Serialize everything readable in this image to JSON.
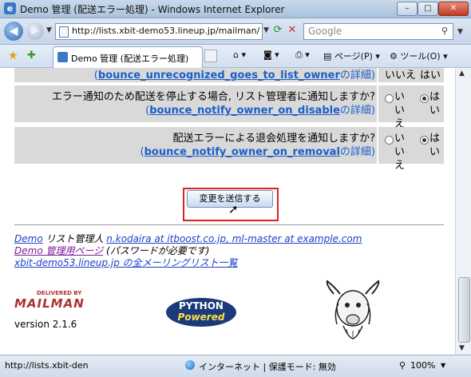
{
  "window": {
    "title": "Demo 管理 (配送エラー処理) - Windows Internet Explorer",
    "minimize_glyph": "–",
    "maximize_glyph": "□",
    "close_glyph": "✕"
  },
  "nav": {
    "address": "http://lists.xbit-demo53.lineup.jp/mailman/",
    "search_placeholder": "Google"
  },
  "toolbar": {
    "tab_label": "Demo 管理 (配送エラー処理)",
    "page_menu": "ページ(P)",
    "tools_menu": "ツール(O)"
  },
  "settings": [
    {
      "question": "",
      "link": "bounce_unrecognized_goes_to_list_owner",
      "link_suffix": "の詳細",
      "options": [
        "いいえ",
        "はい"
      ],
      "selected": 1
    },
    {
      "question": "エラー通知のため配送を停止する場合, リスト管理者に通知しますか?",
      "link": "bounce_notify_owner_on_disable",
      "link_suffix": "の詳細",
      "options": [
        "いいえ",
        "はい"
      ],
      "selected": 1
    },
    {
      "question": "配送エラーによる退会処理を通知しますか?",
      "link": "bounce_notify_owner_on_removal",
      "link_suffix": "の詳細",
      "options": [
        "いいえ",
        "はい"
      ],
      "selected": 1
    }
  ],
  "form": {
    "submit_label": "変更を送信する"
  },
  "footer": {
    "line1": {
      "link": "Demo",
      "text": " リスト管理人 ",
      "email": "n.kodaira at itboost.co.jp, ml-master at example.com"
    },
    "line2": {
      "link": "Demo 管理用ページ",
      "text": " (パスワードが必要です)"
    },
    "line3": {
      "link": "xbit-demo53.lineup.jp の全メーリングリスト一覧"
    },
    "mailman_top": "DELIVERED BY",
    "mailman_main": "MAILMAN",
    "version": "version 2.1.6",
    "python_top": "PYTHON",
    "python_bottom": "Powered"
  },
  "status": {
    "url": "http://lists.xbit-den",
    "zone": "インターネット | 保護モード: 無効",
    "zoom": "100%"
  },
  "icons": [
    "back-icon",
    "forward-icon",
    "refresh-icon",
    "stop-icon",
    "search-icon",
    "favorites-star-icon",
    "add-favorite-icon",
    "home-icon",
    "feeds-icon",
    "print-icon",
    "page-icon",
    "tools-gear-icon",
    "globe-icon",
    "zoom-icon",
    "cursor-icon"
  ]
}
